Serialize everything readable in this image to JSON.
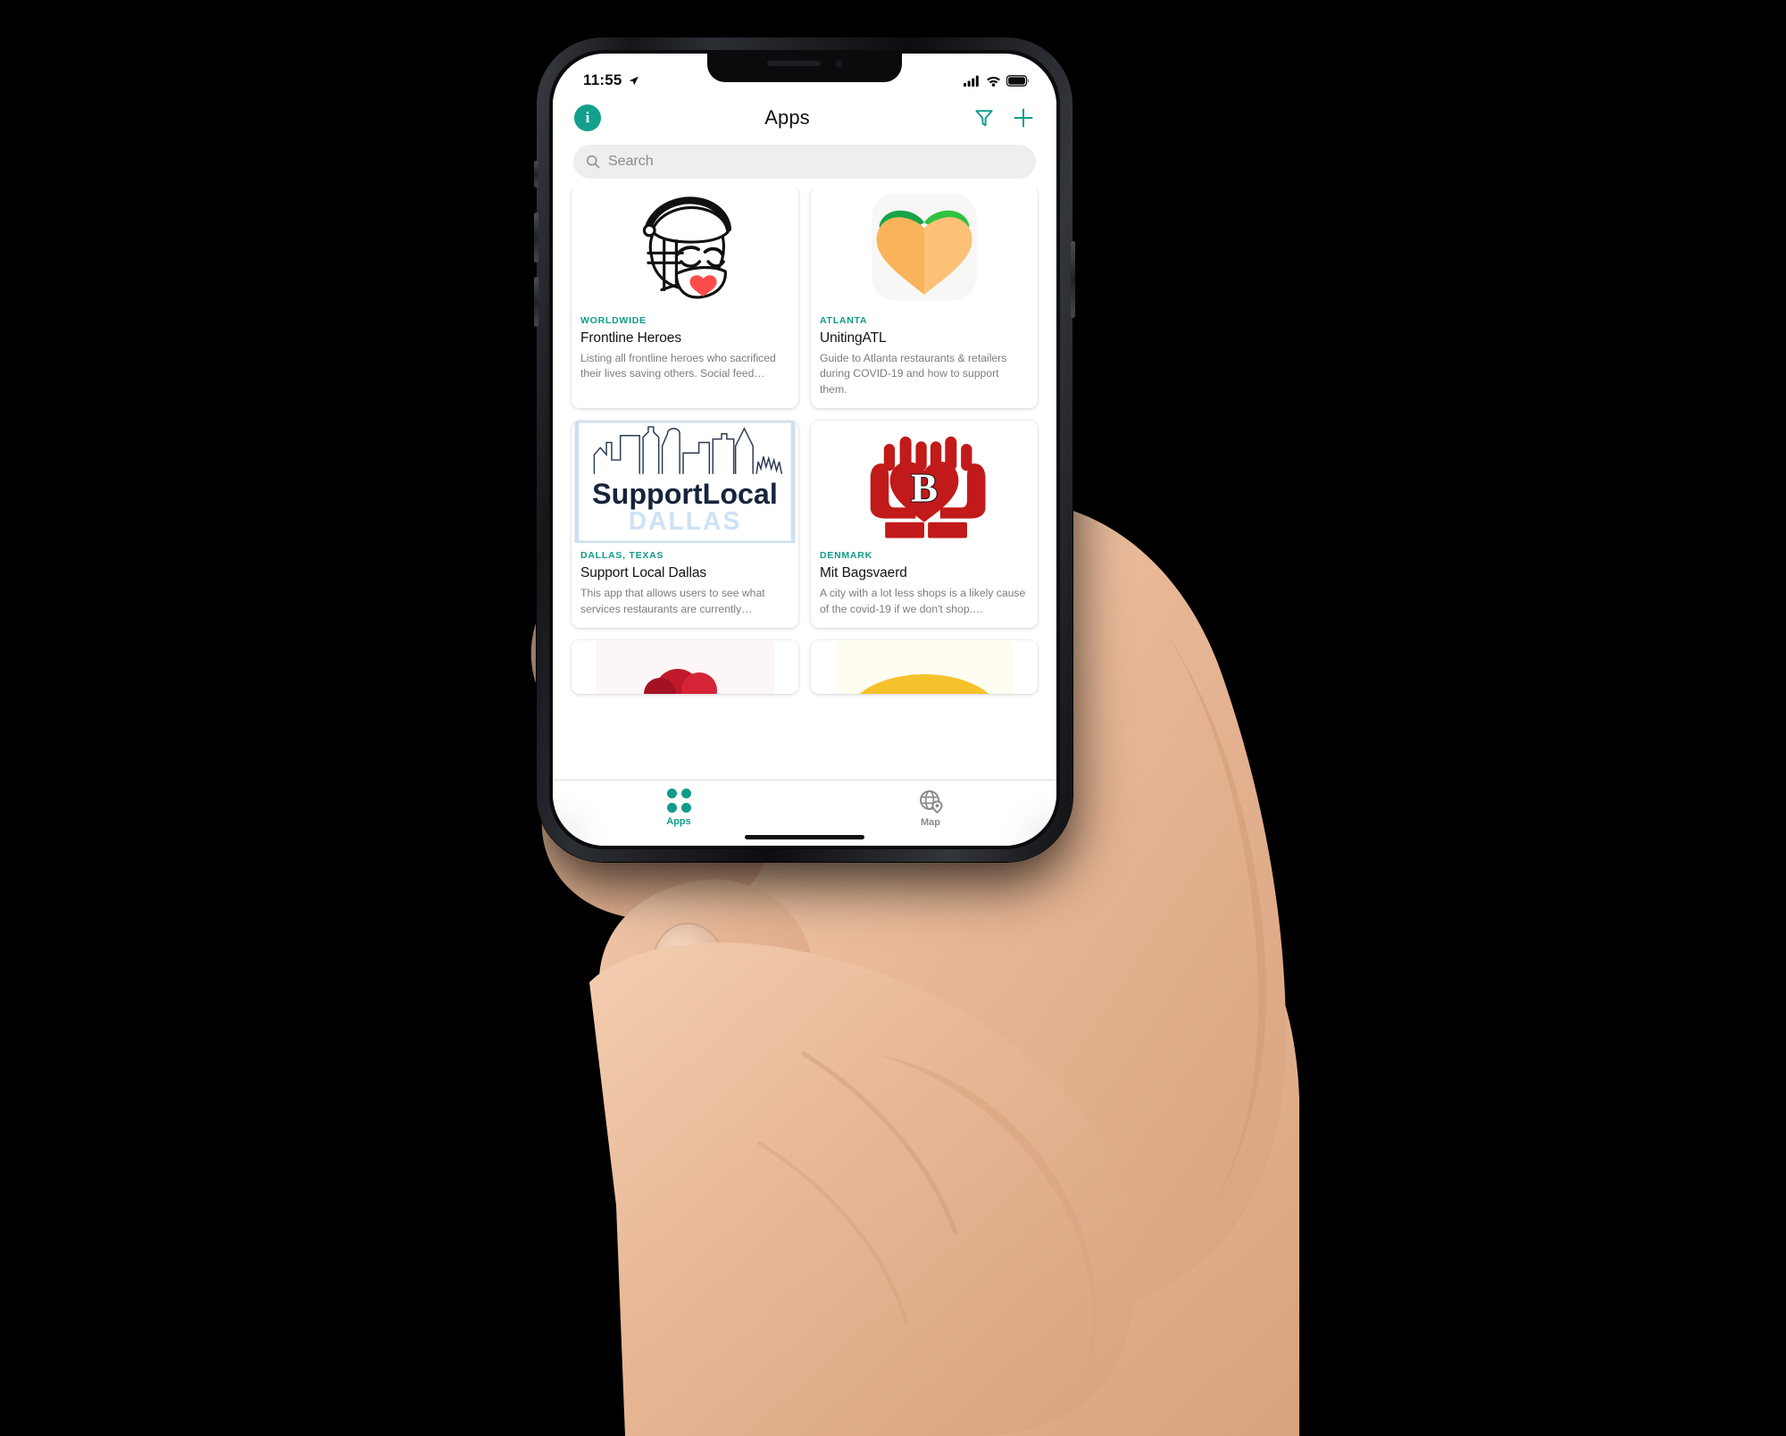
{
  "status_bar": {
    "time": "11:55",
    "location_icon": "location-arrow-icon",
    "signal_icon": "cellular-signal-icon",
    "wifi_icon": "wifi-icon",
    "battery_icon": "battery-icon"
  },
  "nav": {
    "info_label": "i",
    "info_icon": "info-icon",
    "title": "Apps",
    "filter_icon": "filter-funnel-icon",
    "add_icon": "plus-icon"
  },
  "search": {
    "placeholder": "Search",
    "value": "",
    "icon": "search-icon"
  },
  "colors": {
    "accent": "#0f9c88",
    "info_button": "#13a08c",
    "category": "#0f9c88",
    "inactive_tab": "#8a8a8e",
    "search_bg": "#eeeeef"
  },
  "cards": [
    {
      "category": "WORLDWIDE",
      "title": "Frontline Heroes",
      "description": "Listing all frontline heroes who sacrificed their lives saving others. Social feed…",
      "icon": "frontline-heroes-masked-face-icon",
      "selected": false
    },
    {
      "category": "ATLANTA",
      "title": "UnitingATL",
      "description": "Guide to Atlanta restaurants & retailers during COVID-19 and how to support them.",
      "icon": "peach-heart-icon",
      "selected": false
    },
    {
      "category": "DALLAS, TEXAS",
      "title": "Support Local Dallas",
      "description": "This app that allows users to see what services restaurants are currently…",
      "icon": "support-local-dallas-skyline-icon",
      "logo_text_primary": "SupportLocal",
      "logo_text_secondary": "DALLAS",
      "selected": true
    },
    {
      "category": "DENMARK",
      "title": "Mit Bagsvaerd",
      "description": "A city with a lot less shops is a likely cause of the covid-19 if we don't shop.…",
      "icon": "hands-holding-heart-b-icon",
      "logo_letter": "B",
      "selected": false
    }
  ],
  "tabs": [
    {
      "label": "Apps",
      "icon": "apps-grid-icon",
      "active": true
    },
    {
      "label": "Map",
      "icon": "globe-pin-icon",
      "active": false
    }
  ]
}
